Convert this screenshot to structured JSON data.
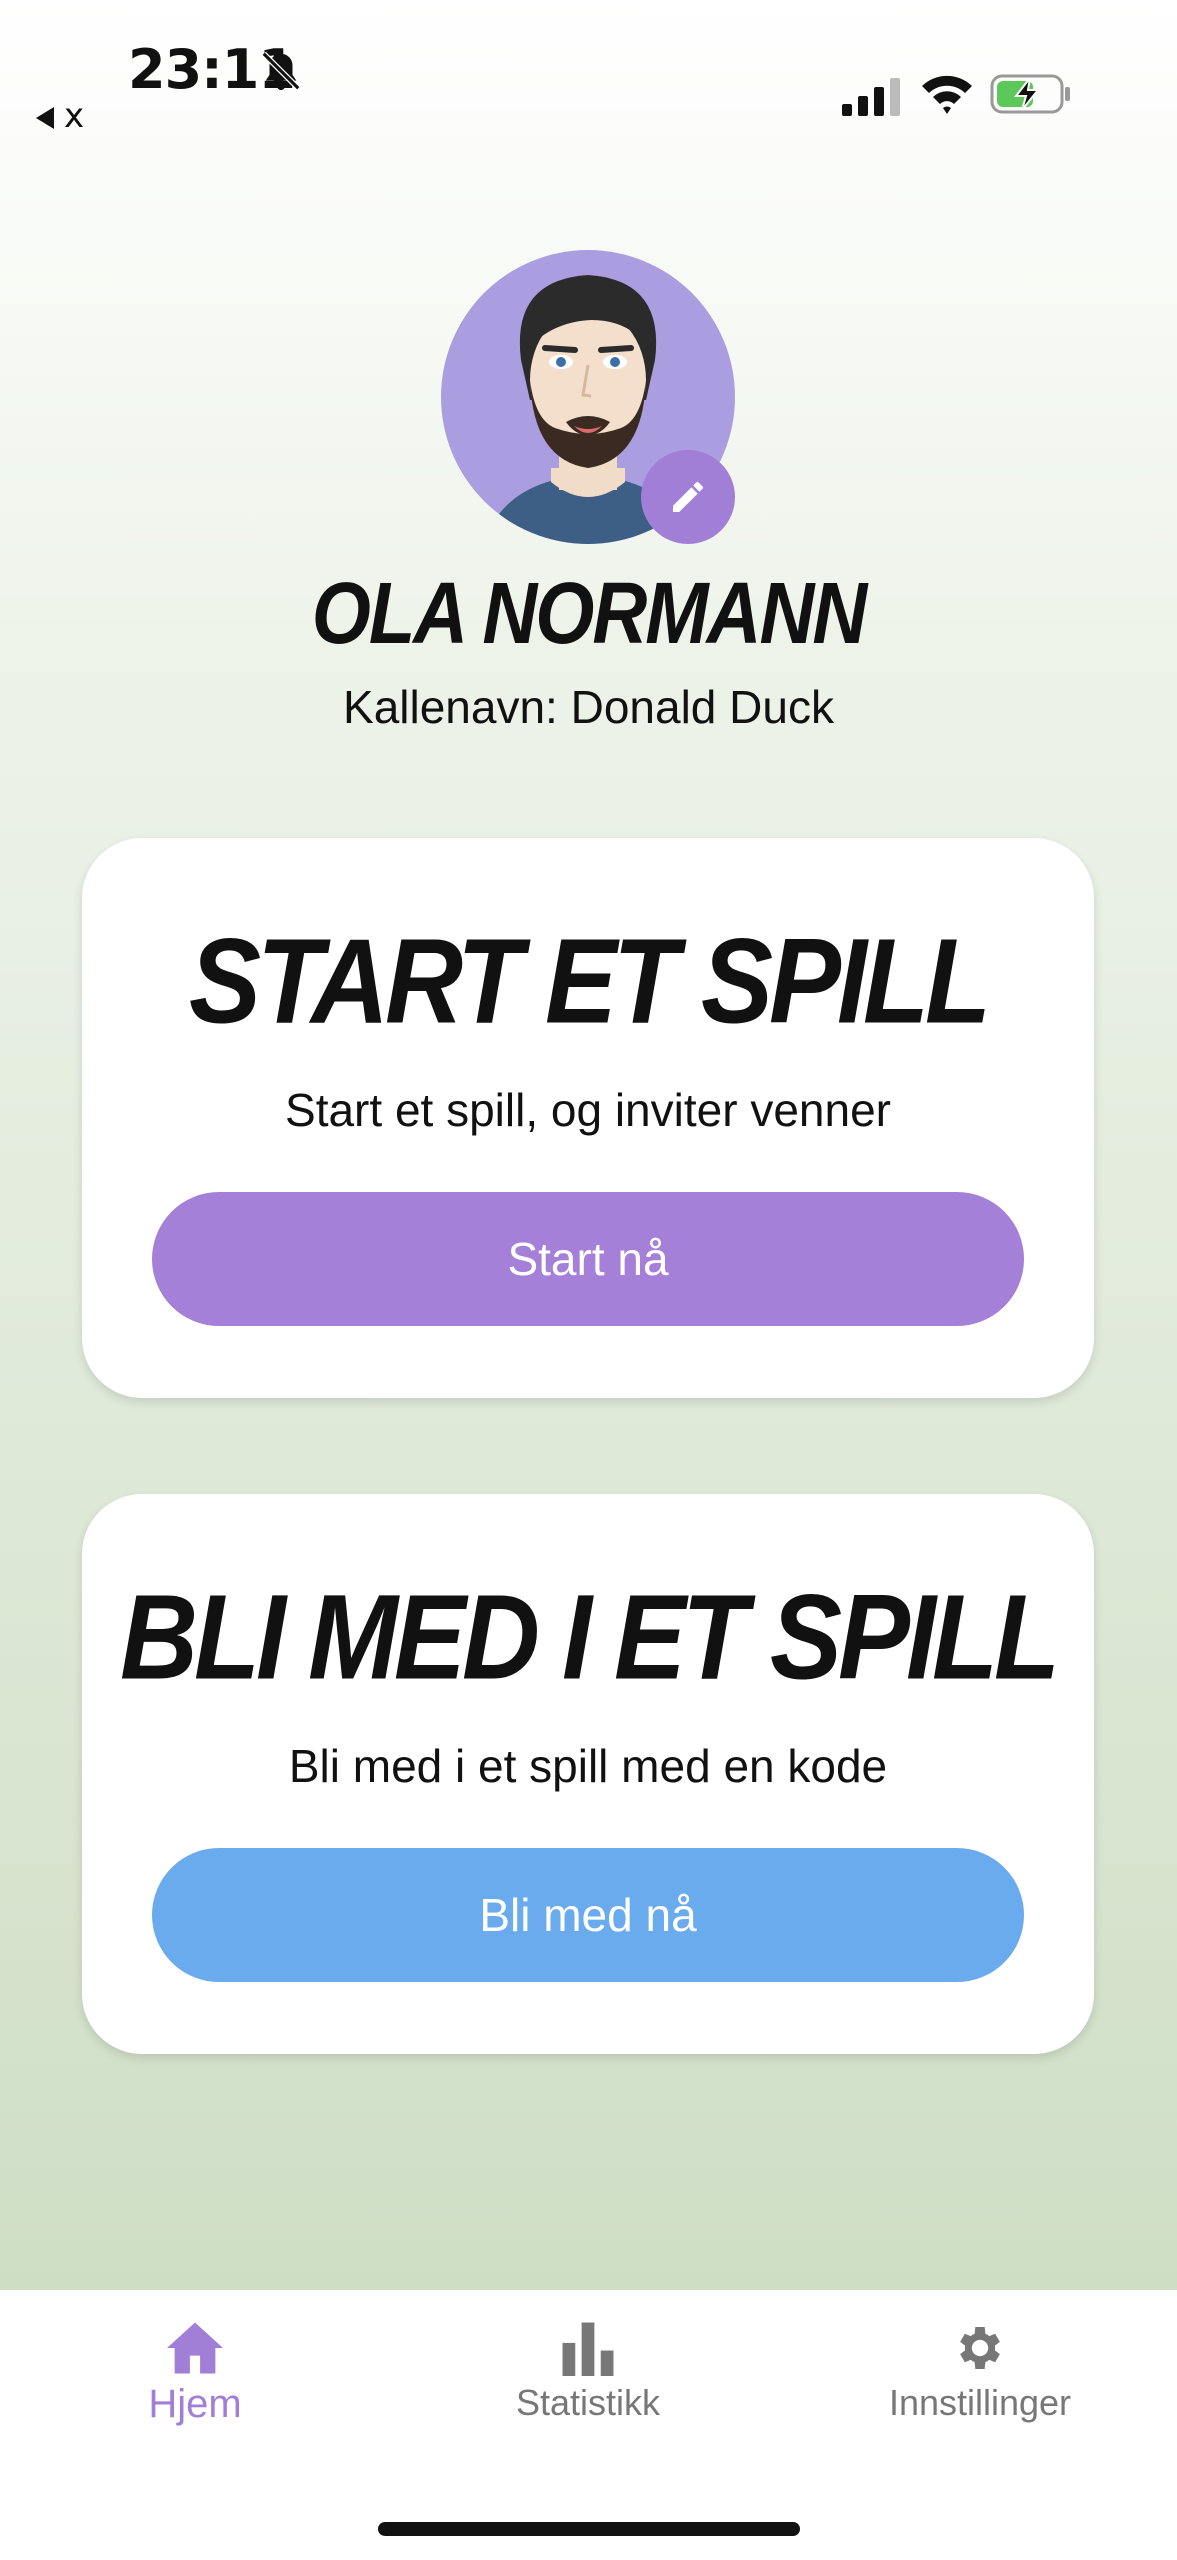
{
  "status_bar": {
    "time": "23:11",
    "back_label": "x"
  },
  "profile": {
    "name": "OLA NORMANN",
    "nickname": "Kallenavn: Donald Duck"
  },
  "cards": [
    {
      "title": "START ET SPILL",
      "description": "Start et spill, og inviter venner",
      "button_label": "Start nå",
      "button_color": "#a480d8"
    },
    {
      "title": "BLI MED I ET SPILL",
      "description": "Bli med i et spill med en kode",
      "button_label": "Bli med nå",
      "button_color": "#6aabee"
    }
  ],
  "tab_bar": {
    "active_color": "#a17fd7",
    "items": [
      {
        "label": "Hjem",
        "icon": "home-icon",
        "active": true
      },
      {
        "label": "Statistikk",
        "icon": "bar-chart-icon",
        "active": false
      },
      {
        "label": "Innstillinger",
        "icon": "gear-icon",
        "active": false
      }
    ]
  }
}
